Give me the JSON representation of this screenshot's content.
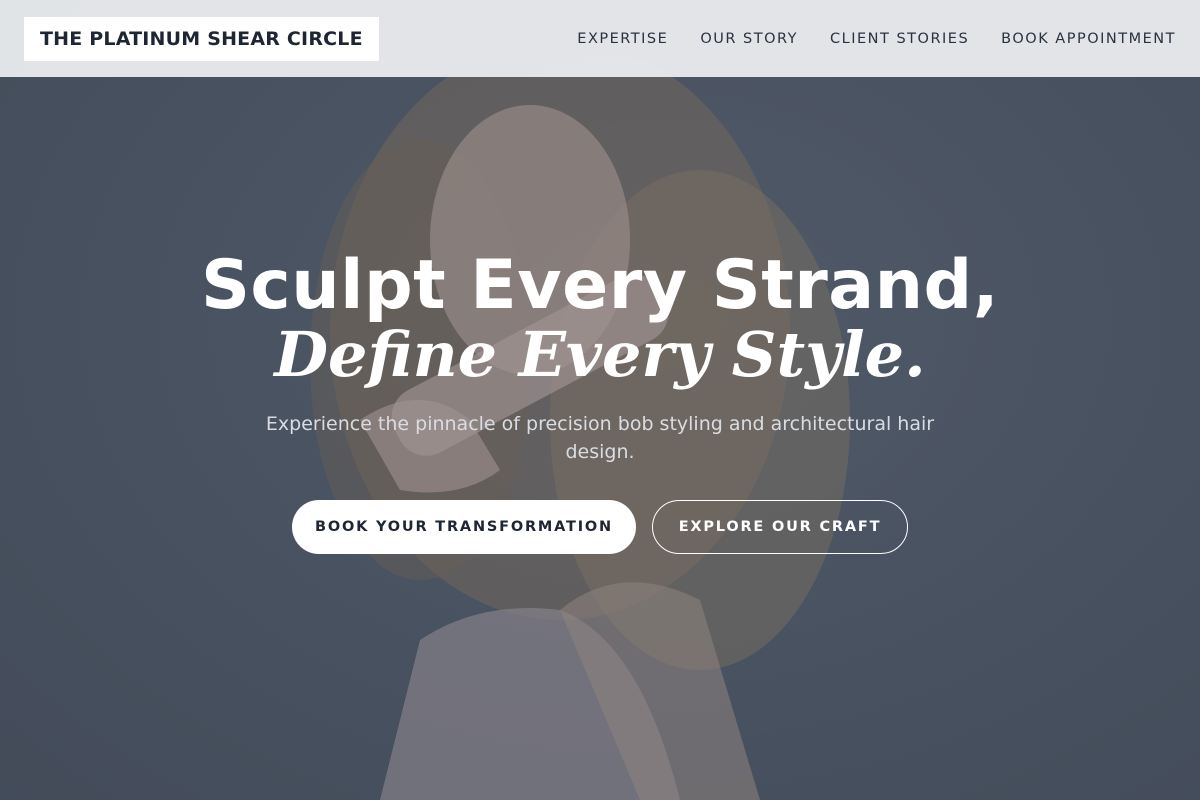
{
  "brand": {
    "name": "THE PLATINUM SHEAR CIRCLE"
  },
  "nav": {
    "items": [
      {
        "label": "EXPERTISE"
      },
      {
        "label": "OUR STORY"
      },
      {
        "label": "CLIENT STORIES"
      },
      {
        "label": "BOOK APPOINTMENT"
      }
    ]
  },
  "hero": {
    "headline_line1": "Sculpt Every Strand,",
    "headline_line2": "Define Every Style.",
    "subtitle": "Experience the pinnacle of precision bob styling and architectural hair design.",
    "primary_cta": "BOOK YOUR TRANSFORMATION",
    "secondary_cta": "EXPLORE OUR CRAFT",
    "image": "woman-with-long-wavy-blonde-hair-holding-hair-tool"
  },
  "colors": {
    "header_bg": "#e8eaed",
    "brand_text": "#1e2533",
    "overlay": "#4f5868",
    "button_primary_bg": "#ffffff",
    "text_light": "#ffffff"
  }
}
